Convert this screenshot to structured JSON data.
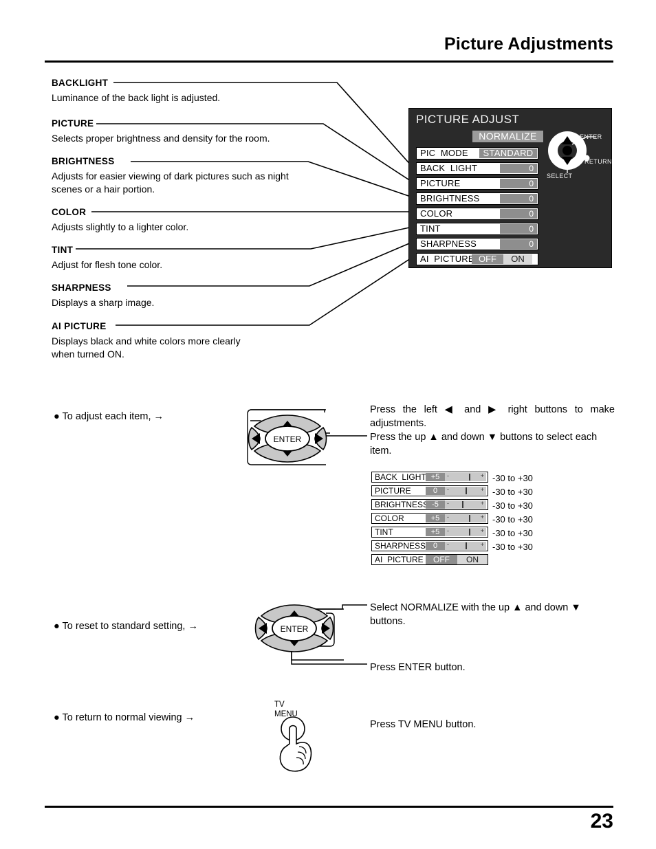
{
  "header": {
    "title": "Picture Adjustments",
    "page_number": "23"
  },
  "descriptions": [
    {
      "term": "BACKLIGHT",
      "body": "Luminance of the back light is adjusted."
    },
    {
      "term": "PICTURE",
      "body": "Selects proper brightness and density for the room."
    },
    {
      "term": "BRIGHTNESS",
      "body": "Adjusts for easier viewing of dark pictures such as night\nscenes or a hair portion."
    },
    {
      "term": "COLOR",
      "body": "Adjusts slightly to a lighter color."
    },
    {
      "term": "TINT",
      "body": "Adjust for flesh tone color."
    },
    {
      "term": "SHARPNESS",
      "body": "Displays a sharp image."
    },
    {
      "term": "AI PICTURE",
      "body": "Displays black and white colors more clearly\nwhen turned ON."
    }
  ],
  "osd": {
    "title": "PICTURE ADJUST",
    "normalize_label": "NORMALIZE",
    "pic_mode": {
      "label": "PIC  MODE",
      "value": "STANDARD"
    },
    "rows": [
      {
        "label": "BACK  LIGHT",
        "value": "0"
      },
      {
        "label": "PICTURE",
        "value": "0"
      },
      {
        "label": "BRIGHTNESS",
        "value": "0"
      },
      {
        "label": "COLOR",
        "value": "0"
      },
      {
        "label": "TINT",
        "value": "0"
      },
      {
        "label": "SHARPNESS",
        "value": "0"
      }
    ],
    "ai_picture": {
      "label": "AI  PICTURE",
      "off": "OFF",
      "on": "ON"
    },
    "navpad": {
      "enter_label": "ENTER",
      "return_label": "RETURN",
      "select_label": "SELECT"
    }
  },
  "steps": [
    {
      "bullet": "● To adjust each item, →",
      "instructions": [
        "Press the left ◀ and ▶ right buttons to make adjustments.",
        "Press the up ▲ and down ▼ buttons to select each item."
      ]
    },
    {
      "bullet": "● To reset to standard setting, →",
      "instructions": [
        "Select NORMALIZE with the up ▲ and down ▼ buttons.",
        "Press ENTER button."
      ]
    },
    {
      "bullet": "● To return to normal viewing →",
      "instructions": [
        "Press TV MENU button."
      ]
    }
  ],
  "adjust_list": {
    "rows": [
      {
        "label": "BACK  LIGHT",
        "value": "+5",
        "minus": "-",
        "plus": "+",
        "knob_pct": 58,
        "range": "-30 to +30"
      },
      {
        "label": "PICTURE",
        "value": "0",
        "minus": "-",
        "plus": "+",
        "knob_pct": 50,
        "range": "-30 to +30"
      },
      {
        "label": "BRIGHTNESS",
        "value": "-5",
        "minus": "-",
        "plus": "+",
        "knob_pct": 42,
        "range": "-30 to +30"
      },
      {
        "label": "COLOR",
        "value": "+5",
        "minus": "-",
        "plus": "+",
        "knob_pct": 58,
        "range": "-30 to +30"
      },
      {
        "label": "TINT",
        "value": "+5",
        "minus": "-",
        "plus": "+",
        "knob_pct": 58,
        "range": "-30 to +30"
      },
      {
        "label": "SHARPNESS",
        "value": "0",
        "minus": "-",
        "plus": "+",
        "knob_pct": 50,
        "range": "-30 to +30"
      }
    ],
    "toggle": {
      "label": "AI  PICTURE",
      "off": "OFF",
      "on": "ON"
    }
  },
  "remote": {
    "enter_label": "ENTER",
    "tv_menu_label": "TV\nMENU"
  },
  "colors": {
    "osd_background": "#2a2a2a",
    "osd_value_fill": "#8e8e8e",
    "osd_row_fill": "#ffffff",
    "highlight_on": "#d8d8d8",
    "remote_button": "#cccccc",
    "page_background": "#ffffff",
    "ink": "#000000"
  }
}
